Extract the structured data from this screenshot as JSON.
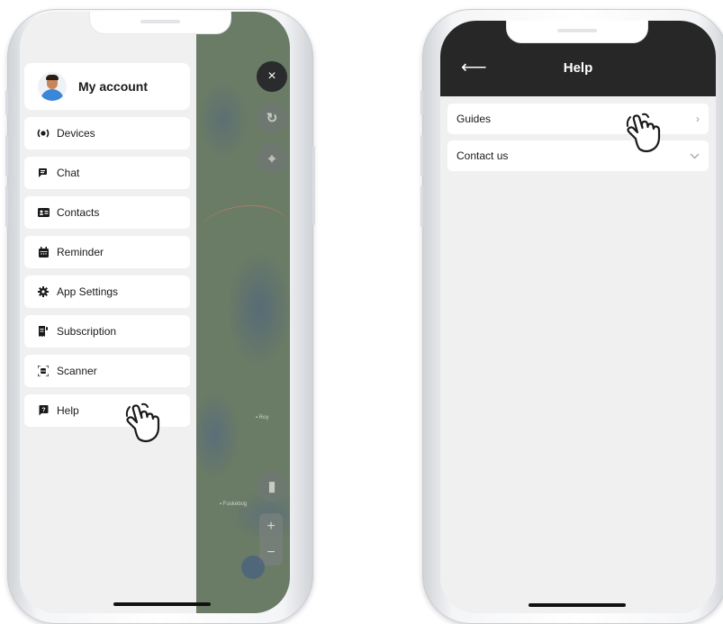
{
  "left_screen": {
    "account": {
      "label": "My account",
      "avatar_icon": "user-avatar"
    },
    "menu": [
      {
        "id": "devices",
        "label": "Devices",
        "icon": "devices-icon"
      },
      {
        "id": "chat",
        "label": "Chat",
        "icon": "chat-icon"
      },
      {
        "id": "contacts",
        "label": "Contacts",
        "icon": "contacts-icon"
      },
      {
        "id": "reminder",
        "label": "Reminder",
        "icon": "calendar-icon"
      },
      {
        "id": "app-settings",
        "label": "App Settings",
        "icon": "gear-icon"
      },
      {
        "id": "subscription",
        "label": "Subscription",
        "icon": "receipt-icon"
      },
      {
        "id": "scanner",
        "label": "Scanner",
        "icon": "scanner-icon"
      },
      {
        "id": "help",
        "label": "Help",
        "icon": "help-icon"
      }
    ],
    "map_controls": {
      "close": "×",
      "refresh": "↻",
      "locate": "⌖",
      "layers": "▮",
      "zoom_in": "+",
      "zoom_out": "−"
    }
  },
  "right_screen": {
    "header": {
      "back": "⟵",
      "title": "Help"
    },
    "sections": [
      {
        "id": "guides",
        "label": "Guides",
        "indicator": "›"
      },
      {
        "id": "contact-us",
        "label": "Contact us",
        "indicator": "⌄"
      }
    ]
  },
  "colors": {
    "header_bg": "#272727",
    "page_bg": "#f0f0f0",
    "card_bg": "#ffffff",
    "close_button": "#2a2b2d"
  }
}
